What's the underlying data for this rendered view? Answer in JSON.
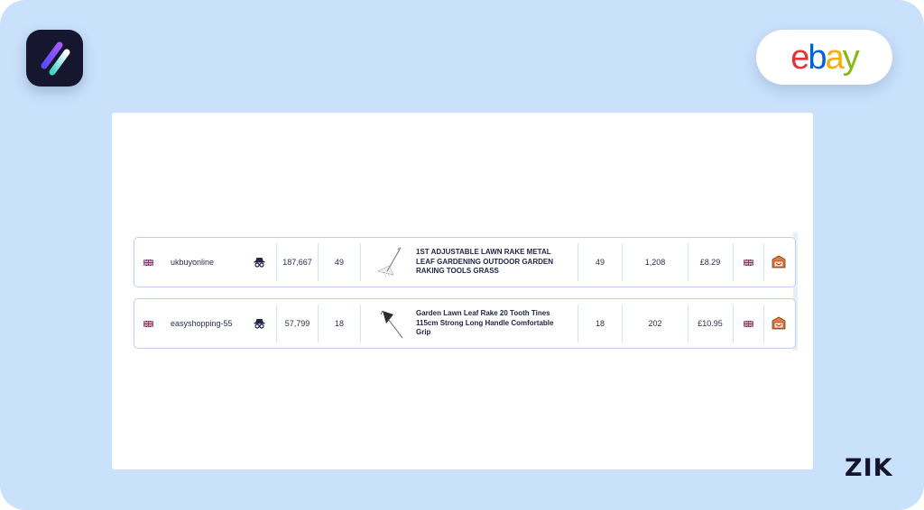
{
  "brand": {
    "overlay_label": "ZIK"
  },
  "ebay": {
    "letters": [
      "e",
      "b",
      "a",
      "y"
    ],
    "colors": [
      "#e53238",
      "#0064d2",
      "#f5af02",
      "#86b817"
    ]
  },
  "listings": [
    {
      "seller": "ukbuyonline",
      "seller_flag": "uk-flag",
      "feedback": "187,667",
      "sales": "49",
      "title": "1ST ADJUSTABLE LAWN RAKE METAL LEAF GARDENING OUTDOOR GARDEN RAKING TOOLS GRASS",
      "sold": "49",
      "total": "1,208",
      "price": "£8.29",
      "ship_flag": "uk-flag"
    },
    {
      "seller": "easyshopping-55",
      "seller_flag": "uk-flag",
      "feedback": "57,799",
      "sales": "18",
      "title": "Garden Lawn Leaf Rake 20 Tooth Tines 115cm Strong Long Handle Comfortable Grip",
      "sold": "18",
      "total": "202",
      "price": "£10.95",
      "ship_flag": "uk-flag"
    }
  ]
}
